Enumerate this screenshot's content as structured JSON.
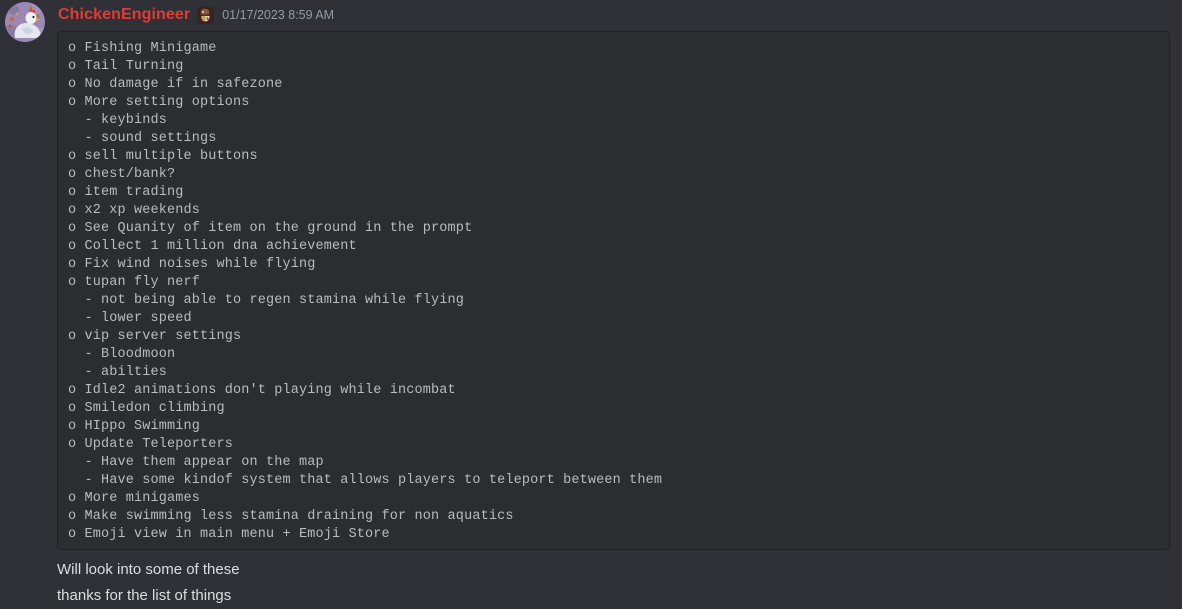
{
  "message": {
    "author": {
      "name": "ChickenEngineer",
      "name_color": "#e03b37",
      "avatar_icon": "chicken-avatar",
      "badge_icon": "guild-badge-icon"
    },
    "timestamp": "01/17/2023 8:59 AM",
    "codeblock": {
      "lines": [
        "o Fishing Minigame",
        "o Tail Turning",
        "o No damage if in safezone",
        "o More setting options",
        "  - keybinds",
        "  - sound settings",
        "o sell multiple buttons",
        "o chest/bank?",
        "o item trading",
        "o x2 xp weekends",
        "o See Quanity of item on the ground in the prompt",
        "o Collect 1 million dna achievement",
        "o Fix wind noises while flying",
        "o tupan fly nerf",
        "  - not being able to regen stamina while flying",
        "  - lower speed",
        "o vip server settings",
        "  - Bloodmoon",
        "  - abilties",
        "o Idle2 animations don't playing while incombat",
        "o Smiledon climbing",
        "o HIppo Swimming",
        "o Update Teleporters",
        "  - Have them appear on the map",
        "  - Have some kindof system that allows players to teleport between them",
        "o More minigames",
        "o Make swimming less stamina draining for non aquatics",
        "o Emoji view in main menu + Emoji Store"
      ],
      "background": "#2b2d31",
      "text_color": "#b9bbbe"
    },
    "reply_lines": [
      "Will look into some of these",
      "thanks for the list of things"
    ]
  }
}
